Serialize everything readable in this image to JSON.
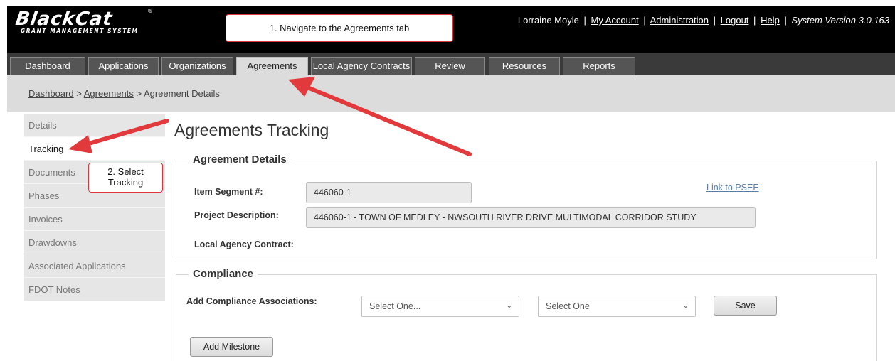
{
  "app": {
    "logo_main": "BlackCat",
    "logo_sub": "GRANT MANAGEMENT SYSTEM",
    "logo_mark": "®"
  },
  "userbar": {
    "user_name": "Lorraine Moyle",
    "my_account": "My Account",
    "administration": "Administration",
    "logout": "Logout",
    "help": "Help",
    "system_version": "System Version 3.0.163",
    "separator": "|"
  },
  "tabs": [
    {
      "label": "Dashboard"
    },
    {
      "label": "Applications"
    },
    {
      "label": "Organizations"
    },
    {
      "label": "Agreements",
      "active": true
    },
    {
      "label": "Local Agency Contracts"
    },
    {
      "label": "Review"
    },
    {
      "label": "Resources"
    },
    {
      "label": "Reports"
    }
  ],
  "breadcrumb": {
    "dashboard": "Dashboard",
    "agreements": "Agreements",
    "current": "Agreement Details",
    "separator": ">"
  },
  "sidebar": {
    "items": [
      {
        "label": "Details"
      },
      {
        "label": "Tracking",
        "active": true
      },
      {
        "label": "Documents"
      },
      {
        "label": "Phases"
      },
      {
        "label": "Invoices"
      },
      {
        "label": "Drawdowns"
      },
      {
        "label": "Associated Applications"
      },
      {
        "label": "FDOT Notes"
      }
    ]
  },
  "main": {
    "title": "Agreements Tracking",
    "agreement_details": {
      "legend": "Agreement Details",
      "item_segment_label": "Item Segment #:",
      "item_segment_value": "446060-1",
      "link_to_psee": "Link to PSEE",
      "project_description_label": "Project Description:",
      "project_description_value": "446060-1 - TOWN OF MEDLEY - NWSOUTH RIVER DRIVE MULTIMODAL CORRIDOR STUDY",
      "local_agency_contract_label": "Local Agency Contract:"
    },
    "compliance": {
      "legend": "Compliance",
      "add_associations_label": "Add Compliance Associations:",
      "select_1_value": "Select One...",
      "select_2_value": "Select One",
      "save_button": "Save",
      "add_milestone_button": "Add Milestone"
    }
  },
  "callouts": {
    "step1": "1. Navigate to the Agreements tab",
    "step2_line1": "2. Select",
    "step2_line2": "Tracking"
  },
  "colors": {
    "header_bg": "#000000",
    "tabbar_bg": "#3a3a3a",
    "tab_bg": "#555555",
    "tab_active_bg": "#dcdcdc",
    "breadcrumb_bg": "#dcdcdc",
    "sidebar_bg": "#e6e6e6",
    "annotation_red": "#e2393c",
    "link_blue": "#5a7fa8"
  },
  "icons": {
    "select_chevron": "chevron-down-icon",
    "arrow": "red-arrow-icon"
  }
}
